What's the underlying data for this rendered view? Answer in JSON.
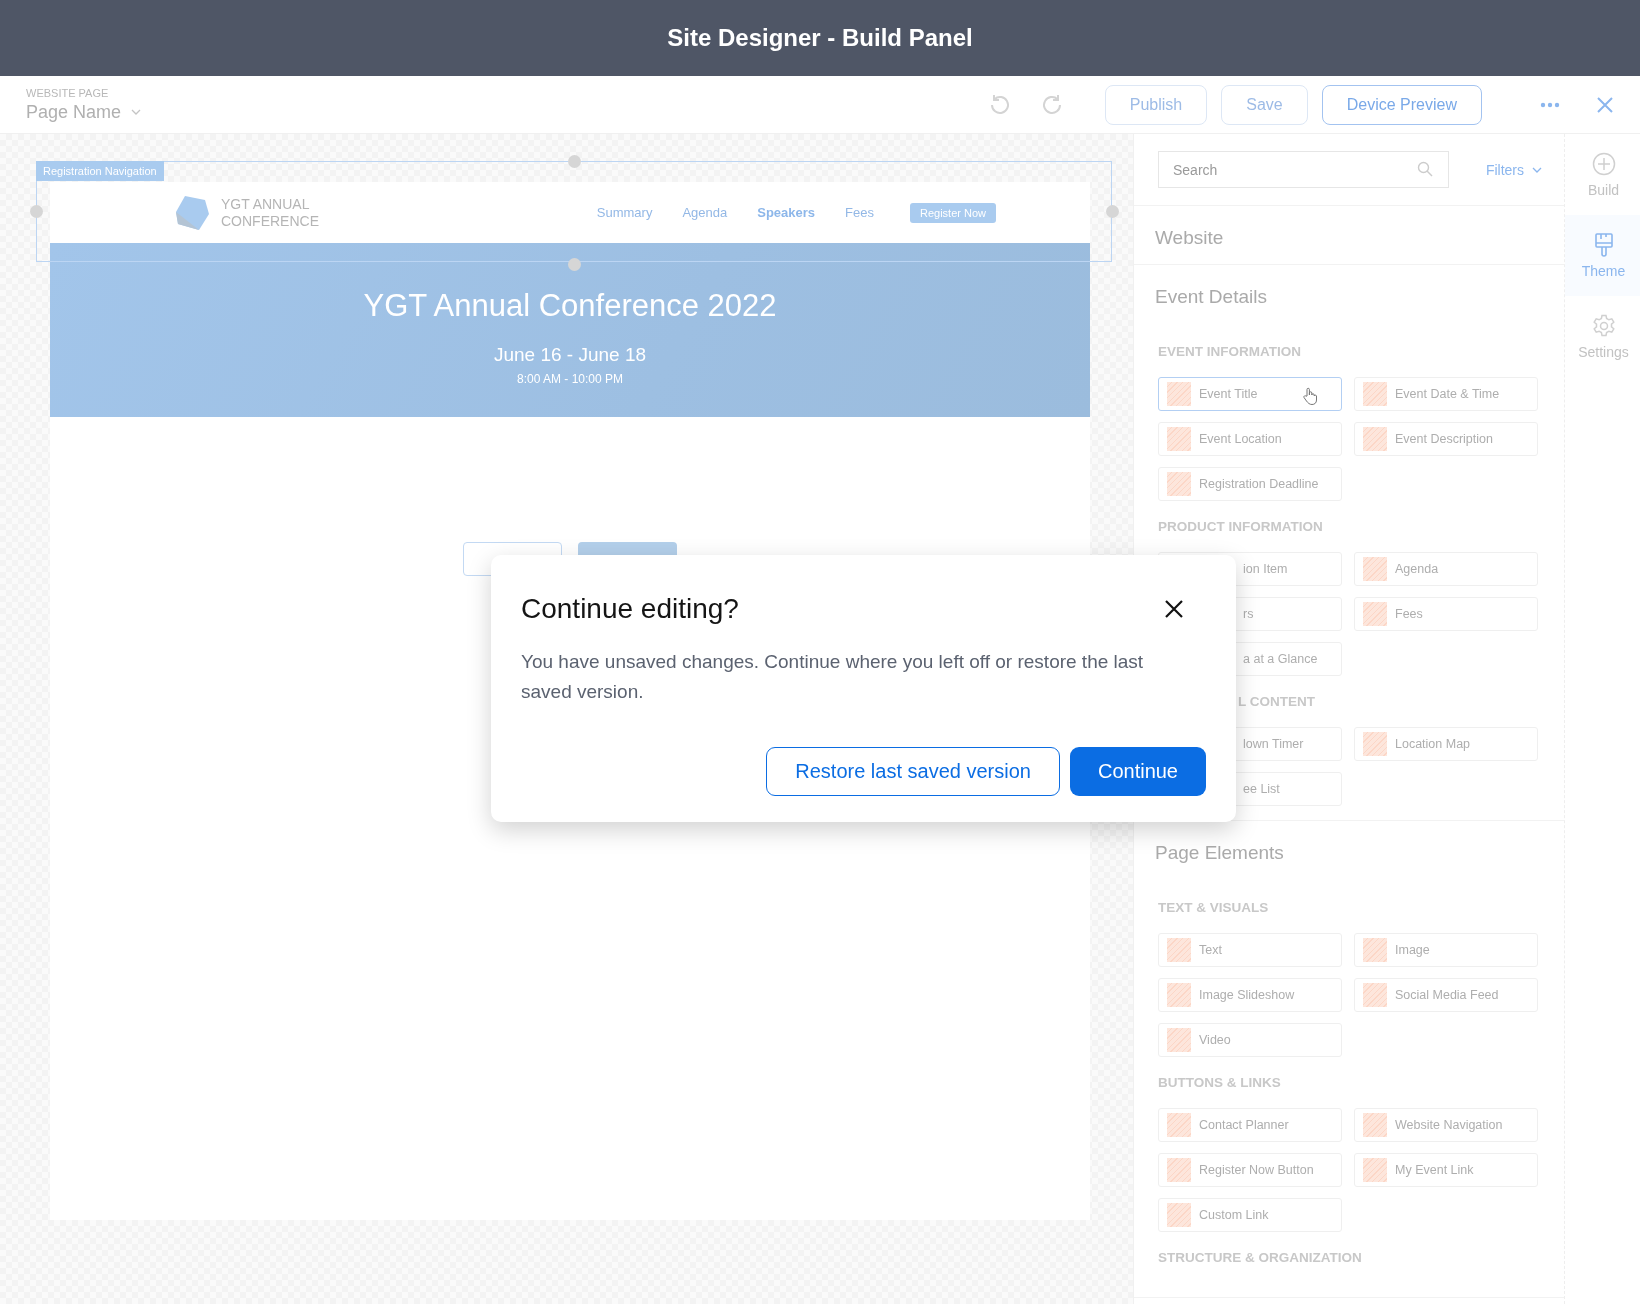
{
  "window": {
    "title": "Site Designer - Build Panel"
  },
  "toolbar": {
    "page_label": "WEBSITE PAGE",
    "page_name": "Page Name",
    "buttons": [
      {
        "label": "Publish",
        "kind": "faded"
      },
      {
        "label": "Save",
        "kind": "faded"
      },
      {
        "label": "Device Preview",
        "kind": "outline"
      }
    ]
  },
  "canvas": {
    "section_label": "Registration Navigation",
    "logo_lines": [
      "YGT ANNUAL",
      "CONFERENCE"
    ],
    "nav_links": [
      {
        "label": "Summary",
        "selected": false
      },
      {
        "label": "Agenda",
        "selected": false
      },
      {
        "label": "Speakers",
        "selected": true
      },
      {
        "label": "Fees",
        "selected": false
      }
    ],
    "cta": "Register Now",
    "hero": {
      "title": "YGT Annual Conference 2022",
      "dates": "June 16 - June 18",
      "times": "8:00 AM - 10:00 PM"
    }
  },
  "panel": {
    "search": {
      "placeholder": "Search"
    },
    "filters": "Filters",
    "sections": [
      {
        "title": "Website"
      },
      {
        "title": "Event Details",
        "groups": [
          {
            "heading": "EVENT INFORMATION",
            "kind": "full",
            "items": [
              {
                "label": "Event Title",
                "kind": "tile",
                "selected": true
              },
              {
                "label": "Event Date & Time",
                "kind": "tile",
                "selected": false
              },
              {
                "label": "Event Location",
                "kind": "tile",
                "selected": false
              },
              {
                "label": "Event Description",
                "kind": "tile",
                "selected": false
              },
              {
                "label": "Registration Deadline",
                "kind": "tile",
                "selected": false
              }
            ]
          },
          {
            "heading": "PRODUCT INFORMATION",
            "kind": "full",
            "items": [
              {
                "label": "ion Item",
                "kind": "covered",
                "selected": false
              },
              {
                "label": "Agenda",
                "kind": "tile",
                "selected": false
              },
              {
                "label": "rs",
                "kind": "covered",
                "selected": false
              },
              {
                "label": "Fees",
                "kind": "tile",
                "selected": false
              },
              {
                "label": "a at a Glance",
                "kind": "covered",
                "selected": false
              }
            ]
          },
          {
            "heading": "L CONTENT",
            "kind": "covered",
            "items": [
              {
                "label": "lown Timer",
                "kind": "covered",
                "selected": false
              },
              {
                "label": "Location Map",
                "kind": "tile",
                "selected": false
              },
              {
                "label": "ee List",
                "kind": "covered",
                "selected": false
              }
            ]
          }
        ]
      },
      {
        "title": "Page Elements",
        "groups": [
          {
            "heading": "TEXT & VISUALS",
            "kind": "full",
            "items": [
              {
                "label": "Text",
                "kind": "tile",
                "selected": false
              },
              {
                "label": "Image",
                "kind": "tile",
                "selected": false
              },
              {
                "label": "Image Slideshow",
                "kind": "tile",
                "selected": false
              },
              {
                "label": "Social Media Feed",
                "kind": "tile",
                "selected": false
              },
              {
                "label": "Video",
                "kind": "tile",
                "selected": false
              }
            ]
          },
          {
            "heading": "BUTTONS & LINKS",
            "kind": "full",
            "items": [
              {
                "label": "Contact Planner",
                "kind": "tile",
                "selected": false
              },
              {
                "label": "Website Navigation",
                "kind": "tile",
                "selected": false
              },
              {
                "label": "Register Now Button",
                "kind": "tile",
                "selected": false
              },
              {
                "label": "My Event Link",
                "kind": "tile",
                "selected": false
              },
              {
                "label": "Custom Link",
                "kind": "tile",
                "selected": false
              }
            ]
          },
          {
            "heading": "STRUCTURE & ORGANIZATION",
            "kind": "full"
          }
        ]
      }
    ]
  },
  "rail": [
    {
      "label": "Build",
      "selected": false
    },
    {
      "label": "Theme",
      "selected": true
    },
    {
      "label": "Settings",
      "selected": false
    }
  ],
  "dialog": {
    "title": "Continue editing?",
    "message": "You have unsaved changes. Continue where you left off or restore the last saved version.",
    "buttons": [
      {
        "label": "Restore last saved version",
        "kind": "secondary"
      },
      {
        "label": "Continue",
        "kind": "primary"
      }
    ]
  }
}
